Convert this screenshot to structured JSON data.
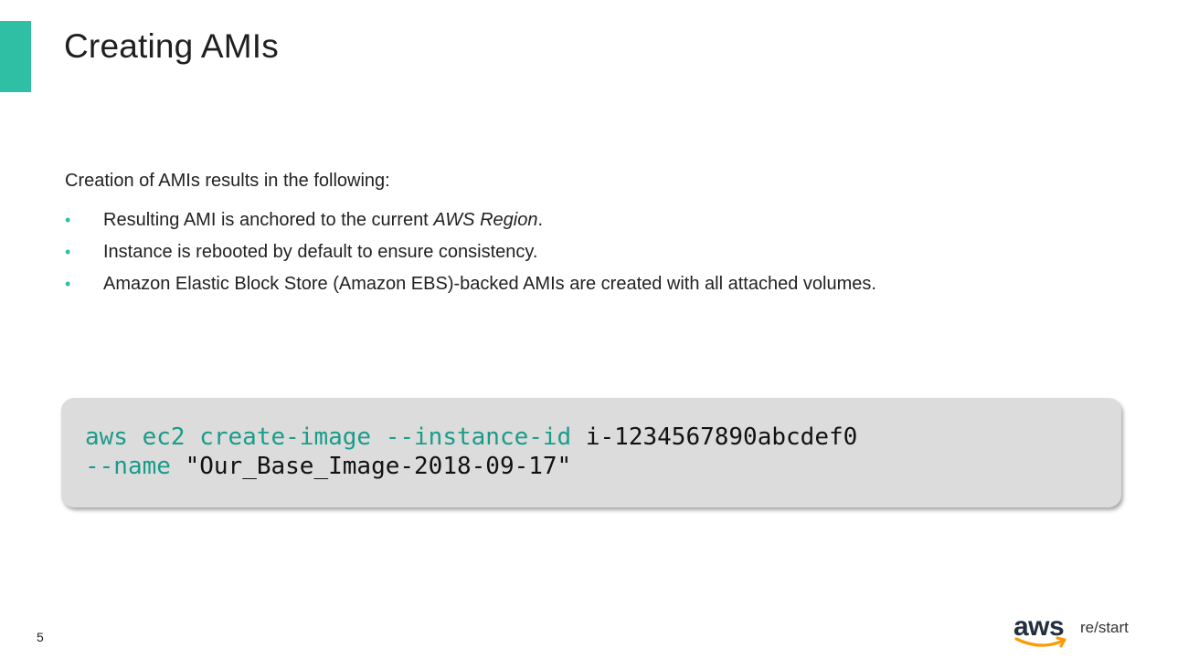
{
  "slide": {
    "title": "Creating AMIs",
    "accent_color": "#2ebfa5",
    "intro": "Creation of AMIs results in the following:",
    "bullets": [
      {
        "before": "Resulting AMI is anchored to the current ",
        "emph": "AWS Region",
        "after": "."
      },
      {
        "text": "Instance is rebooted by default to ensure consistency."
      },
      {
        "text": "Amazon Elastic Block Store (Amazon EBS)-backed AMIs are created with all attached volumes."
      }
    ],
    "bullet_glyph": "•",
    "code": {
      "line1_cmd": "aws ec2 create-image --instance-id",
      "line1_val": " i-1234567890abcdef0",
      "line2_cmd": "--name",
      "line2_val": " \"Our_Base_Image-2018-09-17\"",
      "keyword_color": "#1a9c8a",
      "background": "#dcdcdc"
    },
    "page_number": "5",
    "logo": {
      "brand": "aws",
      "product": "re/start",
      "smile_color": "#ff9900"
    }
  }
}
